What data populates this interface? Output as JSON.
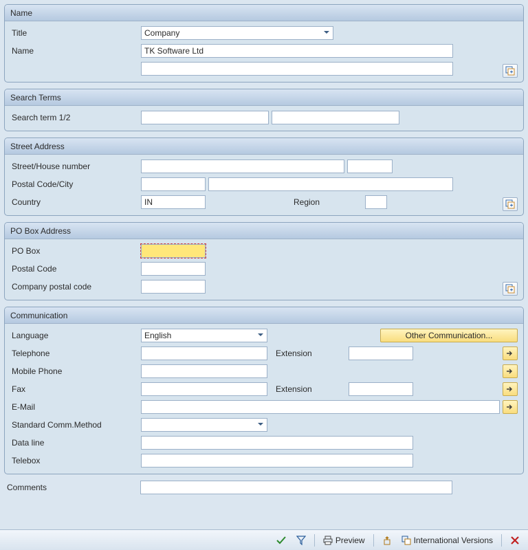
{
  "panels": {
    "name": {
      "title": "Name",
      "title_label": "Title",
      "title_value": "Company",
      "name_label": "Name",
      "name_value": "TK Software Ltd",
      "name2_value": ""
    },
    "search": {
      "title": "Search Terms",
      "term_label": "Search term 1/2",
      "term1": "",
      "term2": ""
    },
    "street": {
      "title": "Street Address",
      "street_label": "Street/House number",
      "street": "",
      "houseno": "",
      "postal_label": "Postal Code/City",
      "postal": "",
      "city": "",
      "country_label": "Country",
      "country": "IN",
      "region_label": "Region",
      "region": ""
    },
    "pobox": {
      "title": "PO Box Address",
      "pobox_label": "PO Box",
      "pobox": "",
      "postal_label": "Postal Code",
      "postal": "",
      "company_label": "Company postal code",
      "company": ""
    },
    "comm": {
      "title": "Communication",
      "language_label": "Language",
      "language": "English",
      "other_label": "Other Communication...",
      "tel_label": "Telephone",
      "tel": "",
      "tel_ext_label": "Extension",
      "tel_ext": "",
      "mobile_label": "Mobile Phone",
      "mobile": "",
      "fax_label": "Fax",
      "fax": "",
      "fax_ext_label": "Extension",
      "fax_ext": "",
      "email_label": "E-Mail",
      "email": "",
      "std_label": "Standard Comm.Method",
      "std": "",
      "data_label": "Data line",
      "data": "",
      "tbox_label": "Telebox",
      "tbox": ""
    }
  },
  "comments": {
    "label": "Comments",
    "value": ""
  },
  "footer": {
    "preview": "Preview",
    "intl": "International Versions"
  }
}
